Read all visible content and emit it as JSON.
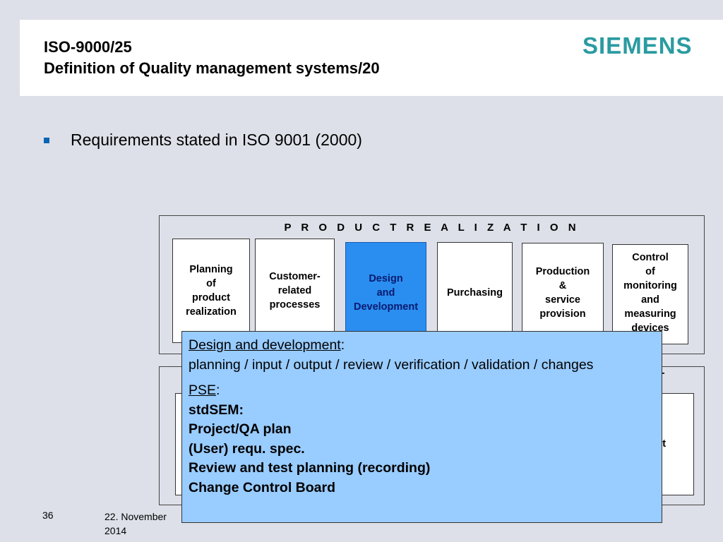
{
  "header": {
    "title_line1": "ISO-9000/25",
    "title_line2": "Definition of Quality management systems/20",
    "logo": "SIEMENS"
  },
  "bullet": {
    "text": "Requirements stated in ISO 9001 (2000)",
    "color": "#0a64b4"
  },
  "product_realization": {
    "title": "P R O D U C T   R E A L I Z A T I O N",
    "processes": [
      "Planning\nof\nproduct\nrealization",
      "Customer-\nrelated\nprocesses",
      "Design\nand\nDevelopment",
      "Purchasing",
      "Production\n&\nservice\nprovision",
      "Control\nof\nmonitoring\nand\nmeasuring\ndevices"
    ],
    "active_index": 2,
    "active_color": "#2a8ef0"
  },
  "measurement_fragments": {
    "top_right": "T",
    "inner_right": "nt"
  },
  "popup": {
    "heading": "Design and development",
    "heading_suffix": ":",
    "body": "planning / input / output / review / verification / validation / changes",
    "pse_label": "PSE",
    "pse_suffix": ":",
    "items": [
      "stdSEM:",
      "Project/QA plan",
      "(User) requ. spec.",
      "Review and test planning (recording)",
      "Change Control Board"
    ],
    "background": "#99ccff"
  },
  "footer": {
    "page_number": "36",
    "date": "22. November\n2014"
  }
}
